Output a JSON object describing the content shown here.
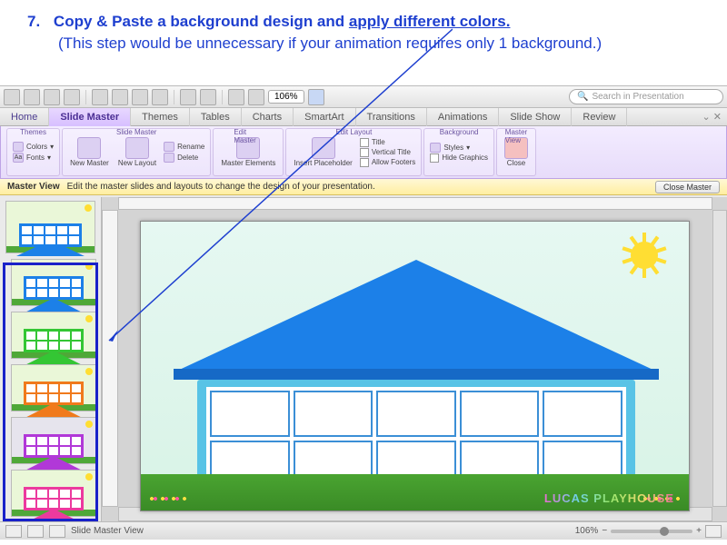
{
  "instruction": {
    "number": "7.",
    "line1_a": "Copy & Paste a background design and ",
    "line1_b": "apply different colors.",
    "line2": "(This step would be unnecessary if your animation requires only 1 background.)"
  },
  "toolbar": {
    "zoom": "106%",
    "search_placeholder": "Search in Presentation"
  },
  "tabs": {
    "home": "Home",
    "slide_master": "Slide Master",
    "themes": "Themes",
    "tables": "Tables",
    "charts": "Charts",
    "smartart": "SmartArt",
    "transitions": "Transitions",
    "animations": "Animations",
    "slide_show": "Slide Show",
    "review": "Review"
  },
  "ribbon": {
    "themes": {
      "title": "Themes",
      "colors": "Colors",
      "fonts": "Fonts"
    },
    "slide_master": {
      "title": "Slide Master",
      "new_master": "New Master",
      "new_layout": "New Layout",
      "rename": "Rename",
      "delete": "Delete"
    },
    "edit_master": {
      "title": "Edit Master",
      "master_elements": "Master Elements"
    },
    "edit_layout": {
      "title": "Edit Layout",
      "insert_placeholder": "Insert Placeholder",
      "title_chk": "Title",
      "vertical_title": "Vertical Title",
      "allow_footers": "Allow Footers"
    },
    "background": {
      "title": "Background",
      "styles": "Styles",
      "hide_graphics": "Hide Graphics"
    },
    "master_view": {
      "title": "Master View",
      "close": "Close"
    }
  },
  "mvbar": {
    "label": "Master View",
    "hint": "Edit the master slides and layouts to change the design of your presentation.",
    "close": "Close Master"
  },
  "thumbs": {
    "colors": [
      "#1c80e8",
      "#1c80e8",
      "#34c634",
      "#f07a1c",
      "#b138d8",
      "#ec3a9e"
    ]
  },
  "slide": {
    "brand": "LUCAS PLAYHOUSE"
  },
  "status": {
    "mode": "Slide Master View",
    "zoom": "106%"
  }
}
